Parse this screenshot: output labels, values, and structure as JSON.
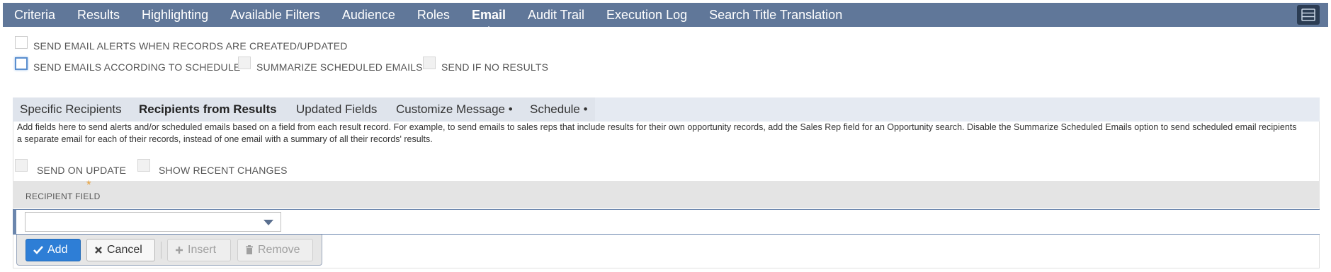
{
  "top_tabs": [
    {
      "label": "Criteria"
    },
    {
      "label": "Results"
    },
    {
      "label": "Highlighting"
    },
    {
      "label": "Available Filters"
    },
    {
      "label": "Audience"
    },
    {
      "label": "Roles"
    },
    {
      "label": "Email",
      "active": true
    },
    {
      "label": "Audit Trail"
    },
    {
      "label": "Execution Log"
    },
    {
      "label": "Search Title Translation"
    }
  ],
  "options": {
    "send_alerts": "SEND EMAIL ALERTS WHEN RECORDS ARE CREATED/UPDATED",
    "send_schedule": "SEND EMAILS ACCORDING TO SCHEDULE",
    "summarize": "SUMMARIZE SCHEDULED EMAILS",
    "send_if_no_results": "SEND IF NO RESULTS"
  },
  "sub_tabs": [
    {
      "label": "Specific Recipients"
    },
    {
      "label": "Recipients from Results",
      "active": true
    },
    {
      "label": "Updated Fields"
    },
    {
      "label": "Customize Message •"
    },
    {
      "label": "Schedule •"
    }
  ],
  "help_text": "Add fields here to send alerts and/or scheduled emails based on a field from each result record. For example, to send emails to sales reps that include results for their own opportunity records, add the Sales Rep field for an Opportunity search. Disable the Summarize Scheduled Emails option to send scheduled email recipients a separate email for each of their records, instead of one email with a summary of all their records' results.",
  "panel_options": {
    "send_on_update": "SEND ON UPDATE",
    "show_recent_changes": "SHOW RECENT CHANGES"
  },
  "table": {
    "column_header": "RECIPIENT FIELD",
    "required_mark": "*",
    "select_value": ""
  },
  "buttons": {
    "add": "Add",
    "cancel": "Cancel",
    "insert": "Insert",
    "remove": "Remove"
  },
  "colors": {
    "header_bg": "#607799",
    "primary": "#2e7ed6",
    "required": "#e8a13a"
  }
}
